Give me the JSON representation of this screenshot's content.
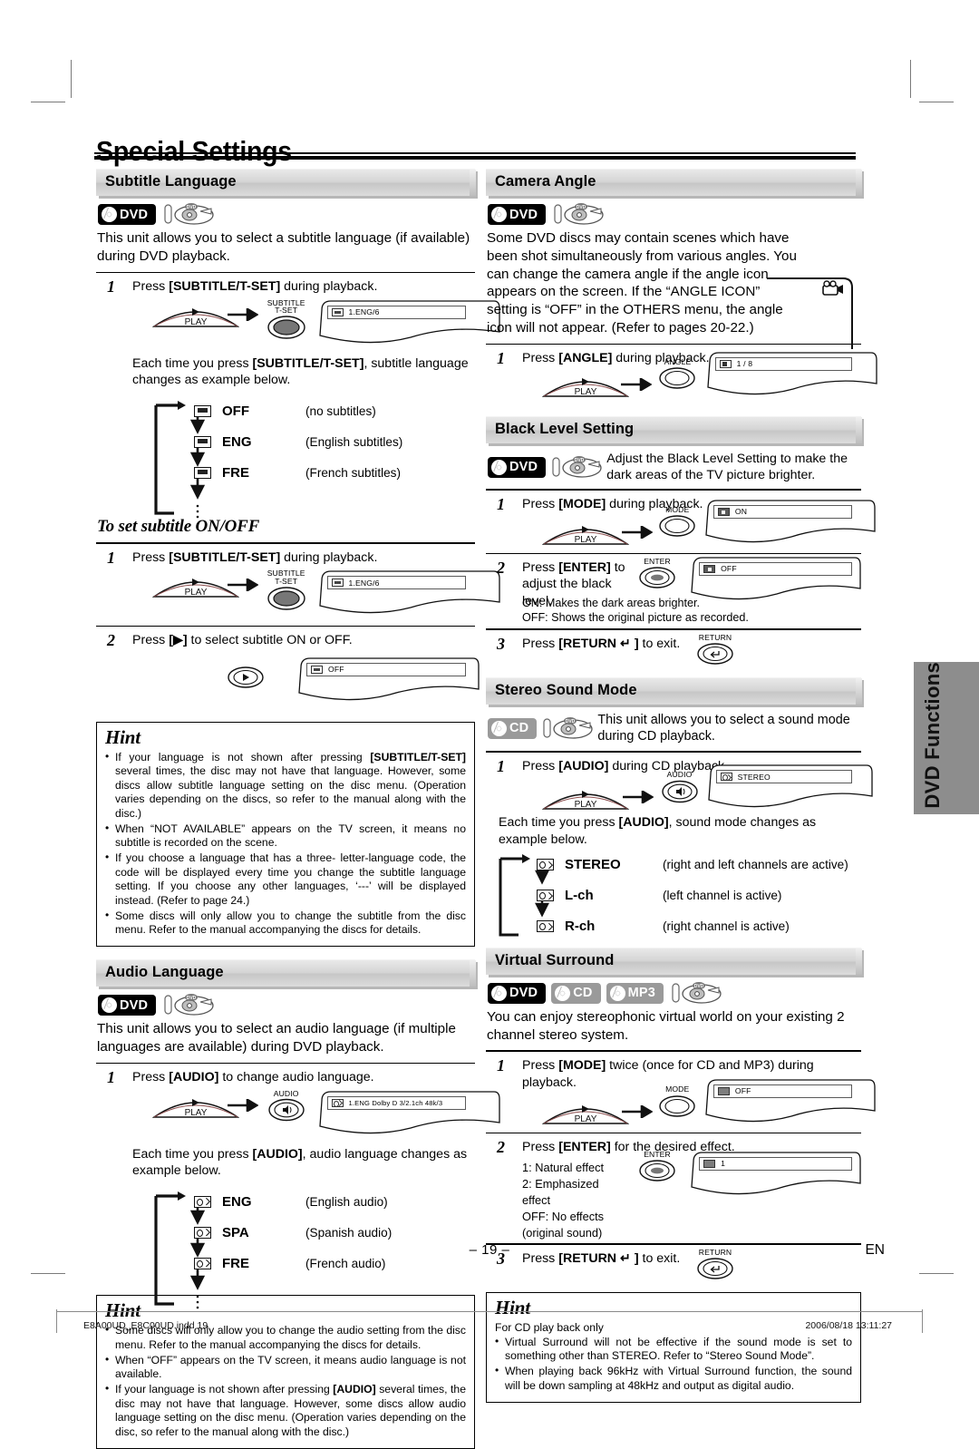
{
  "page": {
    "title": "Special Settings",
    "page_number": "– 19 –",
    "language_mark": "EN",
    "side_tab": "DVD Functions",
    "footer_left": "E8A00UD_E8C00UD.indd   19",
    "footer_right": "2006/08/18   13:11:27"
  },
  "badges": {
    "dvd": "DVD",
    "cd": "CD",
    "mp3": "MP3"
  },
  "sections": {
    "subtitle_language": {
      "heading": "Subtitle Language",
      "intro": "This unit allows you to select a subtitle language (if available) during DVD playback.",
      "step1": {
        "num": "1",
        "text_pre": "Press ",
        "text_key": "[SUBTITLE/T-SET]",
        "text_post": " during playback.",
        "play_label": "PLAY",
        "button_caption": "SUBTITLE\nT-SET",
        "display_value": "1.ENG/6"
      },
      "cycle_intro_pre": "Each time you press ",
      "cycle_intro_key": "[SUBTITLE/T-SET]",
      "cycle_intro_post": ", subtitle language changes as example below.",
      "cycle": [
        {
          "label": "OFF",
          "desc": "(no subtitles)"
        },
        {
          "label": "ENG",
          "desc": "(English subtitles)"
        },
        {
          "label": "FRE",
          "desc": "(French subtitles)"
        }
      ]
    },
    "subtitle_onoff": {
      "heading": "To set subtitle ON/OFF",
      "step1": {
        "num": "1",
        "text_pre": "Press ",
        "text_key": "[SUBTITLE/T-SET]",
        "text_post": " during playback.",
        "play_label": "PLAY",
        "button_caption": "SUBTITLE\nT-SET",
        "display_value": "1.ENG/6"
      },
      "step2": {
        "num": "2",
        "text_pre": "Press ",
        "text_key": "[▶]",
        "text_post": " to select subtitle ON or OFF.",
        "display_value": "OFF"
      }
    },
    "subtitle_hint": {
      "heading": "Hint",
      "items": [
        "If your language is not shown after pressing [SUBTITLE/T-SET] several times, the disc may not have that language. However, some discs allow subtitle language setting on the disc menu. (Operation varies depending on the discs, so refer to the manual along with the disc.)",
        "When “NOT AVAILABLE” appears on the TV screen, it means no subtitle is recorded on the scene.",
        "If you choose a language that has a three- letter-language code, the code will be displayed every time you change the subtitle language setting. If you choose any other languages, ‘---’ will be displayed instead. (Refer to page 24.)",
        "Some discs will only allow you to change the subtitle from the disc menu. Refer to the manual accompanying the discs for details."
      ]
    },
    "audio_language": {
      "heading": "Audio Language",
      "intro": "This unit allows you to select an audio language (if multiple languages are available) during DVD playback.",
      "step1": {
        "num": "1",
        "text_pre": "Press ",
        "text_key": "[AUDIO]",
        "text_post": " to change audio language.",
        "play_label": "PLAY",
        "button_caption": "AUDIO",
        "display_value": "1.ENG  Dolby D  3/2.1ch  48k/3"
      },
      "cycle_intro_pre": "Each time you press ",
      "cycle_intro_key": "[AUDIO]",
      "cycle_intro_post": ", audio language changes as example below.",
      "cycle": [
        {
          "label": "ENG",
          "desc": "(English audio)"
        },
        {
          "label": "SPA",
          "desc": "(Spanish audio)"
        },
        {
          "label": "FRE",
          "desc": "(French audio)"
        }
      ]
    },
    "audio_hint": {
      "heading": "Hint",
      "items": [
        "Some discs will only allow you to change the audio setting from the disc menu. Refer to the manual accompanying the discs for details.",
        "When “OFF” appears on the TV screen, it means audio language is not available.",
        "If your language is not shown after pressing [AUDIO] several times, the disc may not have that language. However, some discs allow audio language setting on the disc menu. (Operation varies depending on the disc, so refer to the manual along with the disc.)"
      ]
    },
    "camera_angle": {
      "heading": "Camera Angle",
      "intro": "Some DVD discs may contain scenes which have been shot simultaneously from various angles. You can change the camera angle if the angle icon appears on the screen. If the “ANGLE ICON” setting is “OFF” in the OTHERS menu, the angle icon will not appear. (Refer to pages 20-22.)",
      "step1": {
        "num": "1",
        "text_pre": "Press ",
        "text_key": "[ANGLE]",
        "text_post": " during playback.",
        "play_label": "PLAY",
        "button_caption": "ANGLE",
        "display_value": "1 / 8"
      }
    },
    "black_level": {
      "heading": "Black Level Setting",
      "intro": "Adjust the Black Level Setting to make the dark areas of the TV picture brighter.",
      "step1": {
        "num": "1",
        "text_pre": "Press ",
        "text_key": "[MODE]",
        "text_post": " during playback.",
        "play_label": "PLAY",
        "button_caption": "MODE",
        "display_value": "ON"
      },
      "step2": {
        "num": "2",
        "text_pre": "Press ",
        "text_key": "[ENTER]",
        "text_post": " to adjust the black level.",
        "button_caption": "ENTER",
        "display_value": "OFF",
        "note_on": "ON: Makes the dark areas brighter.",
        "note_off": "OFF: Shows the original picture as recorded."
      },
      "step3": {
        "num": "3",
        "text_pre": "Press ",
        "text_key": "[RETURN ↵ ]",
        "text_post": " to exit.",
        "button_caption": "RETURN"
      }
    },
    "stereo_sound": {
      "heading": "Stereo Sound Mode",
      "intro": "This unit allows you to select a sound mode during CD playback.",
      "step1": {
        "num": "1",
        "text_pre": "Press ",
        "text_key": "[AUDIO]",
        "text_post": " during CD playback.",
        "play_label": "PLAY",
        "button_caption": "AUDIO",
        "display_value": "STEREO"
      },
      "cycle_intro_pre": "Each time you press ",
      "cycle_intro_key": "[AUDIO]",
      "cycle_intro_post": ", sound mode changes as example below.",
      "cycle": [
        {
          "label": "STEREO",
          "desc": "(right and left channels are active)"
        },
        {
          "label": "L-ch",
          "desc": "(left channel is active)"
        },
        {
          "label": "R-ch",
          "desc": "(right channel is active)"
        }
      ]
    },
    "virtual_surround": {
      "heading": "Virtual Surround",
      "intro": "You can enjoy stereophonic virtual world on your existing 2 channel stereo system.",
      "step1": {
        "num": "1",
        "text_pre": "Press ",
        "text_key": "[MODE]",
        "text_post": " twice (once for CD and MP3) during playback.",
        "play_label": "PLAY",
        "button_caption": "MODE",
        "display_value": "OFF"
      },
      "step2": {
        "num": "2",
        "text_pre": "Press ",
        "text_key": "[ENTER]",
        "text_post": " for the desired effect.",
        "button_caption": "ENTER",
        "display_value": "1",
        "note1": "1: Natural effect",
        "note2": "2: Emphasized effect",
        "note3": "OFF: No effects (original sound)"
      },
      "step3": {
        "num": "3",
        "text_pre": "Press ",
        "text_key": "[RETURN ↵ ]",
        "text_post": " to exit.",
        "button_caption": "RETURN"
      }
    },
    "virtual_hint": {
      "heading": "Hint",
      "lead": "For CD play back only",
      "items": [
        "Virtual Surround will not be effective if the sound mode is set to something other than STEREO. Refer to “Stereo Sound Mode”.",
        "When playing back 96kHz with Virtual Surround function, the sound will be down sampling at 48kHz and output as digital audio."
      ]
    }
  }
}
